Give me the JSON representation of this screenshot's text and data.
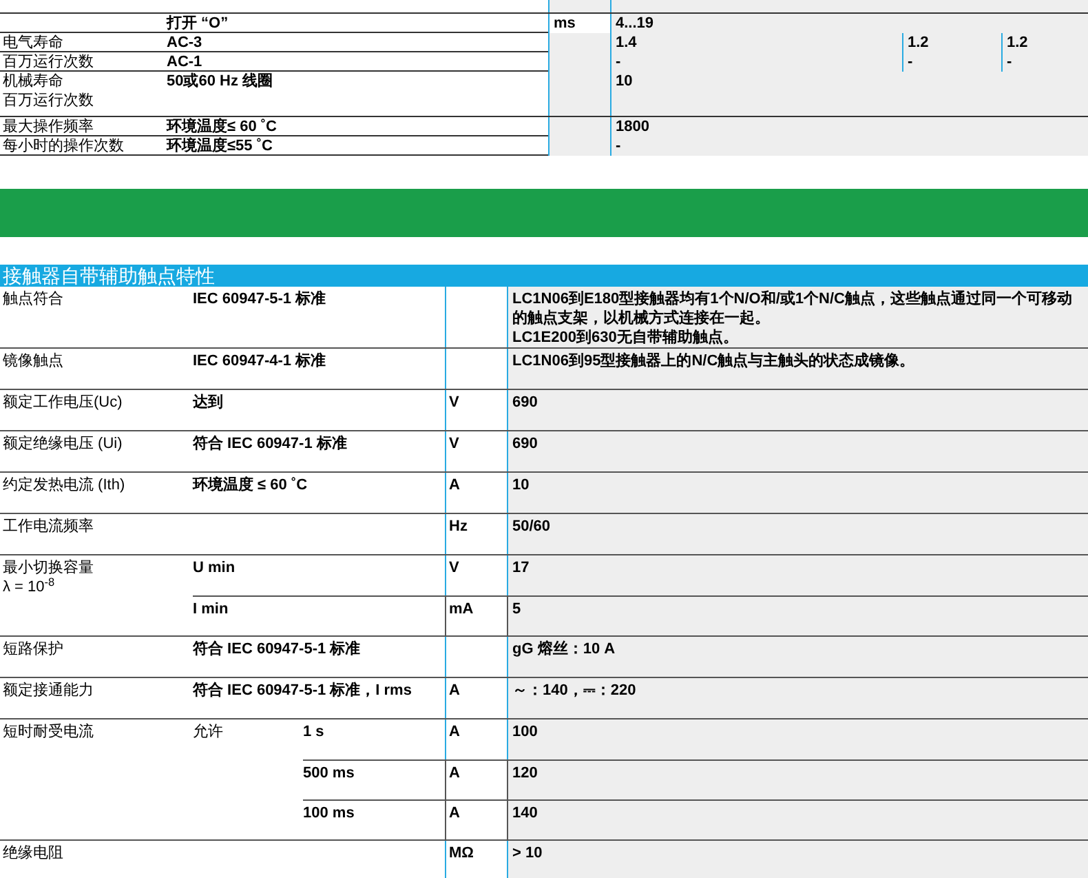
{
  "table_1": {
    "rows": [
      {
        "label": [],
        "condition": "打开 “O”",
        "unit": "ms",
        "values": [
          "4...19"
        ]
      },
      {
        "label": [
          "电气寿命"
        ],
        "condition": "AC-3",
        "unit": "",
        "values": [
          "1.4",
          "1.2",
          "1.2"
        ]
      },
      {
        "label": [
          "百万运行次数"
        ],
        "condition": "AC-1",
        "unit": "",
        "values": [
          "-",
          "-",
          "-"
        ]
      },
      {
        "label": [
          "机械寿命",
          "百万运行次数"
        ],
        "condition": "50或60 Hz 线圈",
        "unit": "",
        "values": [
          "10"
        ]
      },
      {
        "label": [
          "最大操作频率"
        ],
        "condition": "环境温度≤ 60 ˚C",
        "unit": "",
        "values": [
          "1800"
        ]
      },
      {
        "label": [
          "每小时的操作次数"
        ],
        "condition": "环境温度≤55 ˚C",
        "unit": "",
        "values": [
          "-"
        ]
      }
    ]
  },
  "section_title": "接触器自带辅助触点特性",
  "table_2": {
    "groups": [
      {
        "label": "触点符合",
        "rows": [
          {
            "condition": "IEC 60947-5-1 标准",
            "unit": "",
            "value": [
              "LC1N06到E180型接触器均有1个N/O和/或1个N/C触点，这些触点通过同一个可移动的触点支架，以机械方式连接在一起。",
              "LC1E200到630无自带辅助触点。"
            ]
          }
        ]
      },
      {
        "label": "镜像触点",
        "rows": [
          {
            "condition": "IEC 60947-4-1 标准",
            "unit": "",
            "value": [
              "LC1N06到95型接触器上的N/C触点与主触头的状态成镜像。"
            ]
          }
        ]
      },
      {
        "label": "额定工作电压(Uc)",
        "rows": [
          {
            "condition": "达到",
            "unit": "V",
            "value": [
              "690"
            ]
          }
        ]
      },
      {
        "label": "额定绝缘电压 (Ui)",
        "rows": [
          {
            "condition": "符合 IEC 60947-1 标准",
            "unit": "V",
            "value": [
              "690"
            ]
          }
        ]
      },
      {
        "label": "约定发热电流 (Ith)",
        "rows": [
          {
            "condition": "环境温度 ≤ 60 ˚C",
            "unit": "A",
            "value": [
              "10"
            ]
          }
        ]
      },
      {
        "label": "工作电流频率",
        "rows": [
          {
            "condition": "",
            "unit": "Hz",
            "value": [
              "50/60"
            ]
          }
        ]
      },
      {
        "label": "最小切换容量\nλ = 10$^{-8}$",
        "rows": [
          {
            "condition": "U min",
            "unit": "V",
            "value": [
              "17"
            ]
          },
          {
            "condition": "I min",
            "unit": "mA",
            "value": [
              "5"
            ]
          }
        ]
      },
      {
        "label": "短路保护",
        "rows": [
          {
            "condition": "符合 IEC 60947-5-1 标准",
            "unit": "",
            "value": [
              "gG 熔丝：10 A"
            ]
          }
        ]
      },
      {
        "label": "额定接通能力",
        "rows": [
          {
            "condition": "符合 IEC 60947-5-1 标准，I rms",
            "unit": "A",
            "value": [
              "～：140，⎓：220"
            ]
          }
        ]
      },
      {
        "label": "短时耐受电流",
        "condition": "允许",
        "rows": [
          {
            "condition": "1 s",
            "unit": "A",
            "value": [
              "100"
            ]
          },
          {
            "condition": "500 ms",
            "unit": "A",
            "value": [
              "120"
            ]
          },
          {
            "condition": "100 ms",
            "unit": "A",
            "value": [
              "140"
            ]
          }
        ]
      },
      {
        "label": "绝缘电阻",
        "rows": [
          {
            "condition": "",
            "unit": "MΩ",
            "value": [
              "> 10"
            ]
          }
        ]
      }
    ]
  }
}
